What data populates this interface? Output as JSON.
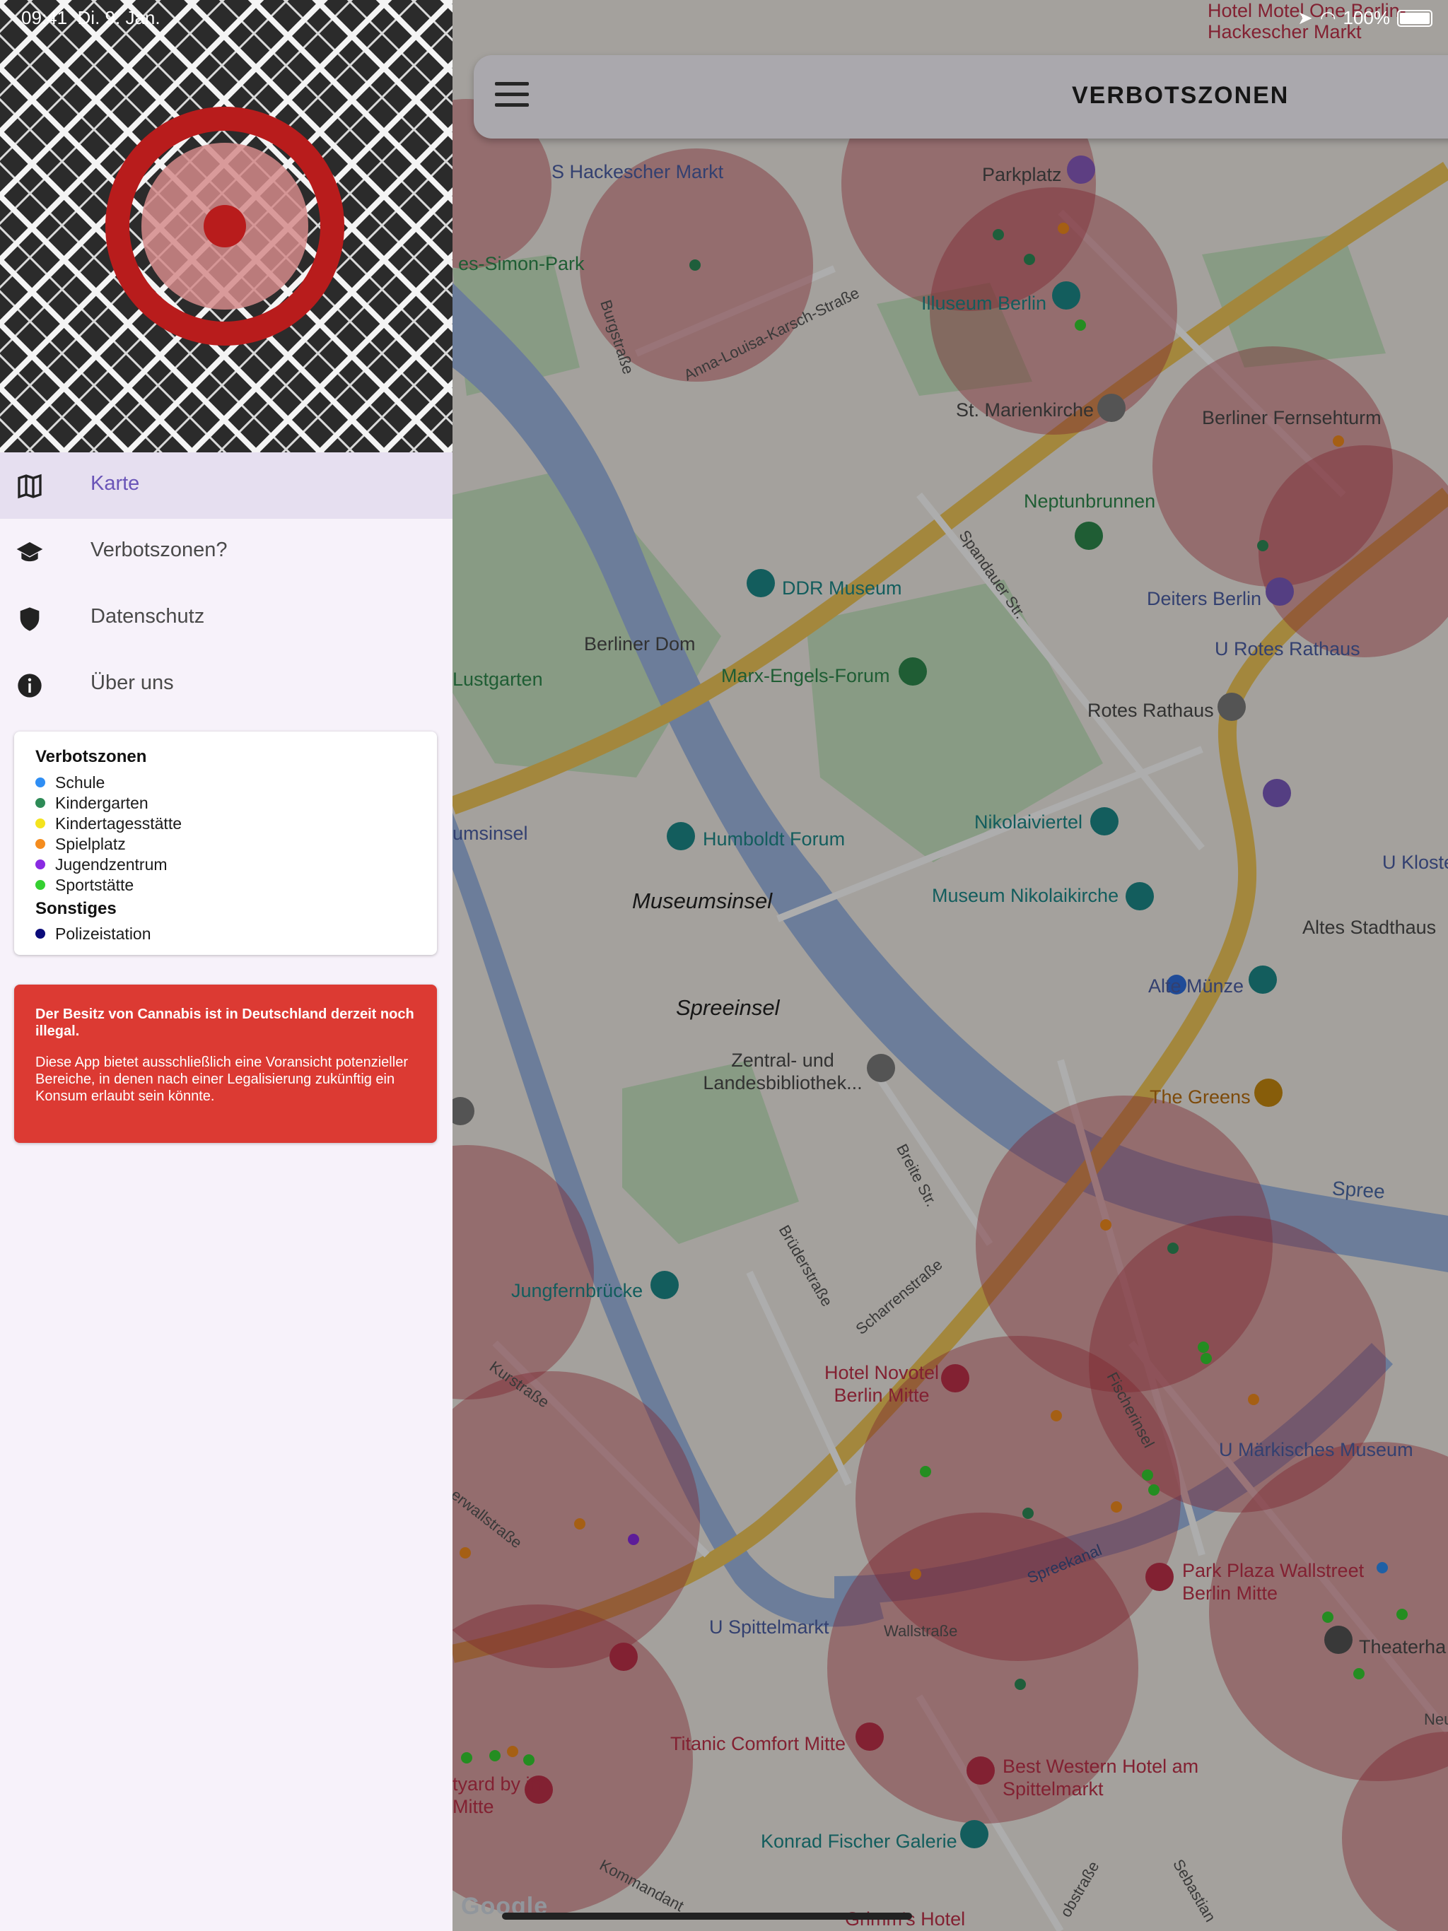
{
  "status_bar": {
    "time": "09:41",
    "date": "Di. 9. Jan.",
    "battery": "100%"
  },
  "app_bar": {
    "title": "VERBOTSZONEN"
  },
  "drawer": {
    "nav": [
      {
        "label": "Karte",
        "icon": "map-icon"
      },
      {
        "label": "Verbotszonen?",
        "icon": "graduation-cap-icon"
      },
      {
        "label": "Datenschutz",
        "icon": "shield-icon"
      },
      {
        "label": "Über uns",
        "icon": "info-icon"
      }
    ],
    "legend": {
      "heading": "Verbotszonen",
      "items": [
        {
          "label": "Schule",
          "color": "#2f8ef4"
        },
        {
          "label": "Kindergarten",
          "color": "#2e8b57"
        },
        {
          "label": "Kindertagesstätte",
          "color": "#f4e31e"
        },
        {
          "label": "Spielplatz",
          "color": "#f48c1e"
        },
        {
          "label": "Jugendzentrum",
          "color": "#8a2be2"
        },
        {
          "label": "Sportstätte",
          "color": "#35d031"
        }
      ],
      "other_heading": "Sonstiges",
      "other_items": [
        {
          "label": "Polizeistation",
          "color": "#0b0b7a"
        }
      ]
    },
    "warning": {
      "bold": "Der Besitz von Cannabis ist in Deutschland derzeit noch illegal.",
      "text": "Diese App bietet ausschließlich eine Voransicht potenzieller Bereiche, in denen nach einer Legalisierung zukünftig ein Konsum erlaubt sein könnte."
    }
  },
  "map": {
    "labels": [
      "S Hackescher Markt",
      "Parkplatz",
      "Hotel Motel One Berlin-Hackescher Markt",
      "es-Simon-Park",
      "Illuseum Berlin",
      "St. Marienkirche",
      "Berliner Fernsehturm",
      "Neptunbrunnen",
      "DDR Museum",
      "Berliner Dom",
      "Deiters Berlin",
      "U Rotes Rathaus",
      "Marx-Engels-Forum",
      "Lustgarten",
      "Rotes Rathaus",
      "Humboldt Forum",
      "umsinsel",
      "Nikolaiviertel",
      "Museumsinsel",
      "Museum Nikolaikirche",
      "U Kloste",
      "Altes Stadthaus",
      "Alte Münze",
      "Spreeinsel",
      "Zentral- und Landesbibliothek...",
      "The Greens",
      "Spree",
      "Jungfernbrücke",
      "Hotel Novotel Berlin Mitte",
      "U Märkisches Museum",
      "Park Plaza Wallstreet Berlin Mitte",
      "U Spittelmarkt",
      "Theaterha",
      "Titanic Comfort Mitte",
      "Best Western Hotel am Spittelmarkt",
      "Konrad Fischer Galerie",
      "tyard by in-Mitte",
      "Breite Str.",
      "Spandauer Str.",
      "Brüderstraße",
      "Scharrenstraße",
      "Fischerinsel",
      "Kurstraße",
      "Wallstraße",
      "Spreekanal",
      "Burgstraße",
      "Anna-Louisa-Karsch-Straße",
      "Neue",
      "Grimm's Hotel",
      "Kommandant",
      "Sebastian",
      "obstraße",
      "erwallstraße"
    ],
    "attribution": "Google"
  }
}
